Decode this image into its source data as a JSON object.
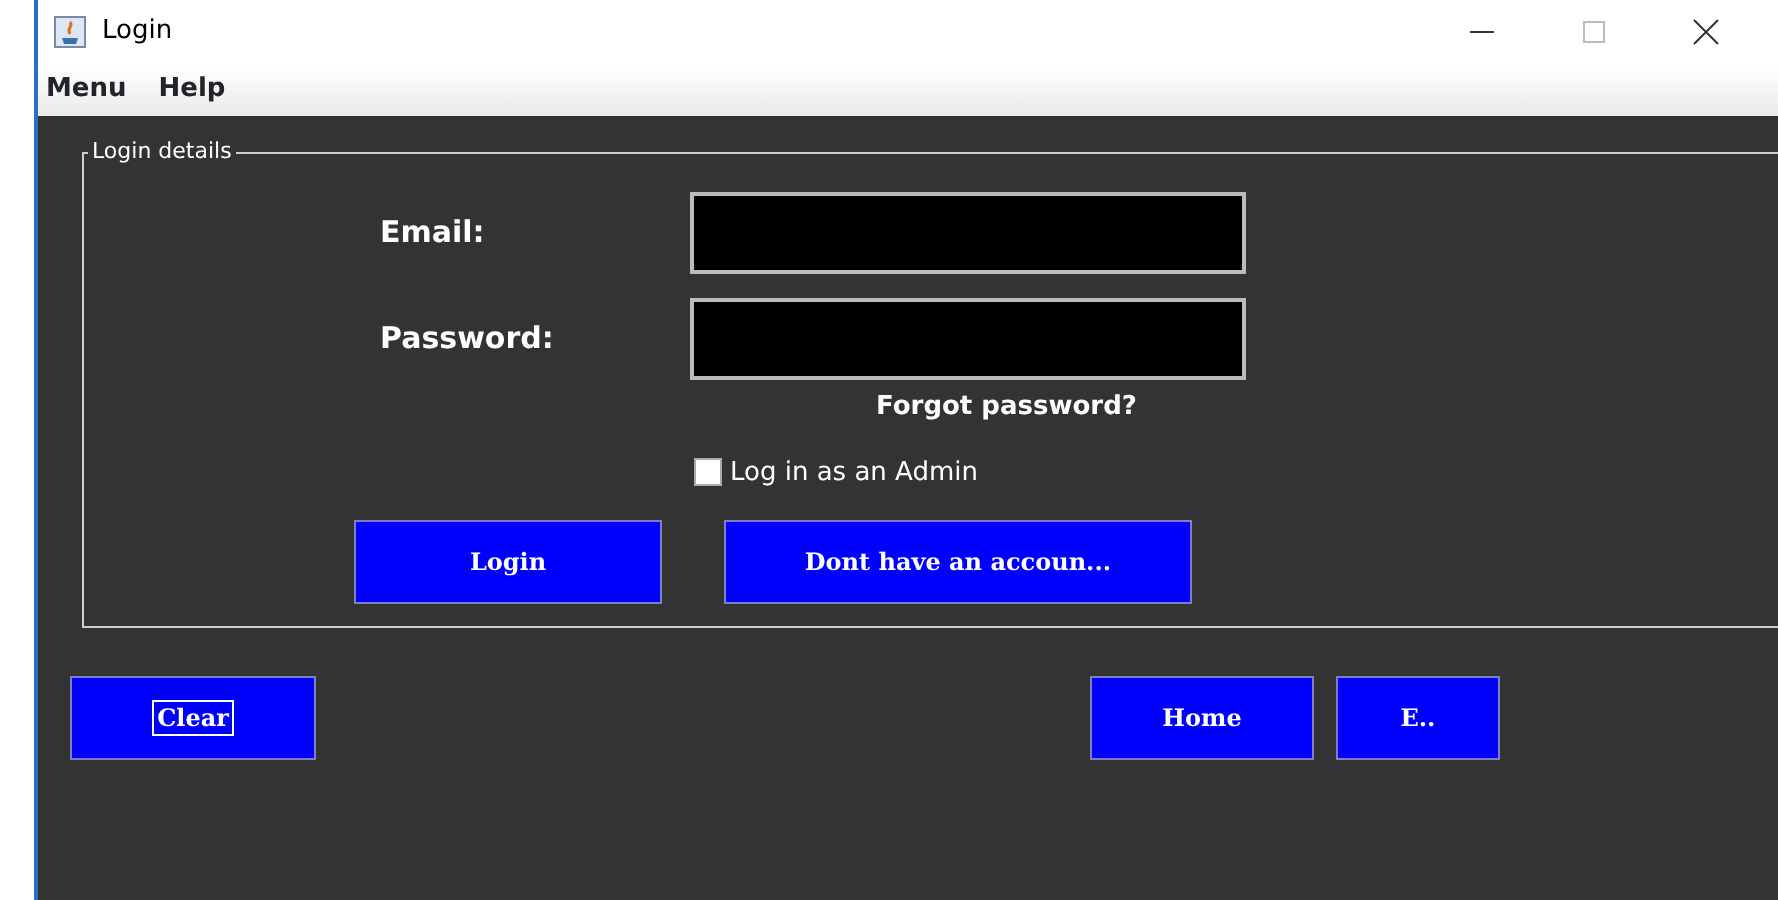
{
  "window": {
    "title": "Login"
  },
  "menu": [
    "Menu",
    "Help"
  ],
  "login_details": {
    "legend": "Login details",
    "fields": [
      {
        "label": "Email:"
      },
      {
        "label": "Password:"
      }
    ],
    "forgot_link": "Forgot password?",
    "admin_checkbox": {
      "label": "Log in as an Admin",
      "checked": false
    },
    "buttons": [
      {
        "label": "Login",
        "focused": false
      },
      {
        "label": "Dont have an accoun...",
        "focused": false
      }
    ]
  },
  "bottom_buttons": [
    {
      "label": "Clear",
      "focused": true
    },
    {
      "label": "Home",
      "focused": false
    },
    {
      "label": "E..",
      "focused": false
    }
  ]
}
